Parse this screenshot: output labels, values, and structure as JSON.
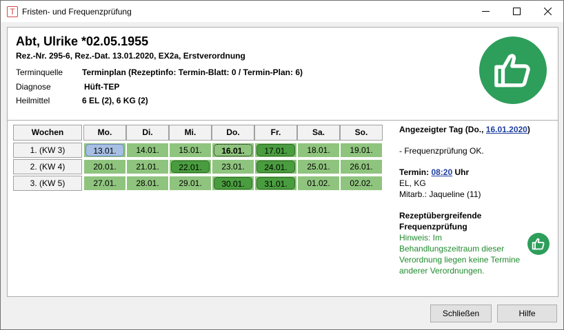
{
  "window": {
    "title": "Fristen- und Frequenzprüfung",
    "icon": "app-t-icon"
  },
  "patient": {
    "name": "Abt, Ulrike *02.05.1955",
    "rez_line": "Rez.-Nr. 295-6, Rez.-Dat. 13.01.2020, EX2a, Erstverordnung"
  },
  "info": [
    {
      "label": "Terminquelle",
      "value": "Terminplan (Rezeptinfo: Termin-Blatt: 0 / Termin-Plan: 6)"
    },
    {
      "label": "Diagnose",
      "value": "Hüft-TEP"
    },
    {
      "label": "Heilmittel",
      "value": "6 EL (2), 6 KG (2)"
    }
  ],
  "calendar": {
    "headers": [
      "Wochen",
      "Mo.",
      "Di.",
      "Mi.",
      "Do.",
      "Fr.",
      "Sa.",
      "So."
    ],
    "rows": [
      {
        "week": "1. (KW 3)",
        "days": [
          "13.01.",
          "14.01.",
          "15.01.",
          "16.01.",
          "17.01.",
          "18.01.",
          "19.01."
        ]
      },
      {
        "week": "2. (KW 4)",
        "days": [
          "20.01.",
          "21.01.",
          "22.01.",
          "23.01.",
          "24.01.",
          "25.01.",
          "26.01."
        ]
      },
      {
        "week": "3. (KW 5)",
        "days": [
          "27.01.",
          "28.01.",
          "29.01.",
          "30.01.",
          "31.01.",
          "01.02.",
          "02.02."
        ]
      }
    ]
  },
  "detail": {
    "shown_day_prefix": "Angezeigter Tag (Do., ",
    "shown_day_date": "16.01.2020",
    "shown_day_suffix": ")",
    "check_result": "- Frequenzprüfung OK.",
    "termin_label": "Termin: ",
    "termin_time": "08:20",
    "termin_unit": " Uhr",
    "termin_items": "EL, KG",
    "mitarbeiter": "Mitarb.: Jaqueline (11)",
    "cross_title_1": "Rezeptübergreifende",
    "cross_title_2": "Frequenzprüfung",
    "hint_lines": [
      "Hinweis: Im",
      "Behandlungszeitraum dieser",
      "Verordnung liegen keine Termine",
      "anderer Verordnungen."
    ]
  },
  "buttons": {
    "close": "Schließen",
    "help": "Hilfe"
  },
  "colors": {
    "cell_green": "#8fc47e",
    "appointment_green": "#4a9d3f",
    "selected_blue": "#a7bfe3",
    "thumb_green": "#2e9e5b",
    "link_blue": "#1f3fa0",
    "hint_green": "#1f8a2c"
  }
}
